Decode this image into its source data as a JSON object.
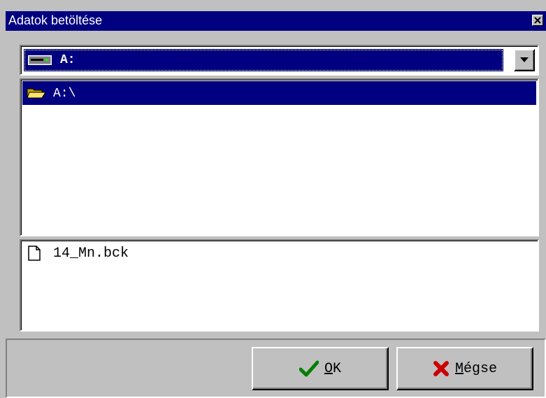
{
  "window": {
    "title": "Adatok betöltése",
    "close_icon": "close-icon"
  },
  "drive_select": {
    "value": "A:",
    "icon": "floppy-drive-icon"
  },
  "directory_list": {
    "items": [
      {
        "label": "A:\\",
        "icon": "open-folder-icon",
        "selected": true
      }
    ]
  },
  "file_list": {
    "items": [
      {
        "label": "14_Mn.bck",
        "icon": "file-icon"
      }
    ]
  },
  "buttons": {
    "ok": {
      "accel": "O",
      "rest": "K",
      "icon": "checkmark-icon"
    },
    "cancel": {
      "accel": "M",
      "rest": "égse",
      "icon": "x-icon"
    }
  },
  "colors": {
    "selection": "#000080",
    "face": "#c0c0c0",
    "ok_icon": "#008000",
    "cancel_icon": "#cc0000"
  }
}
